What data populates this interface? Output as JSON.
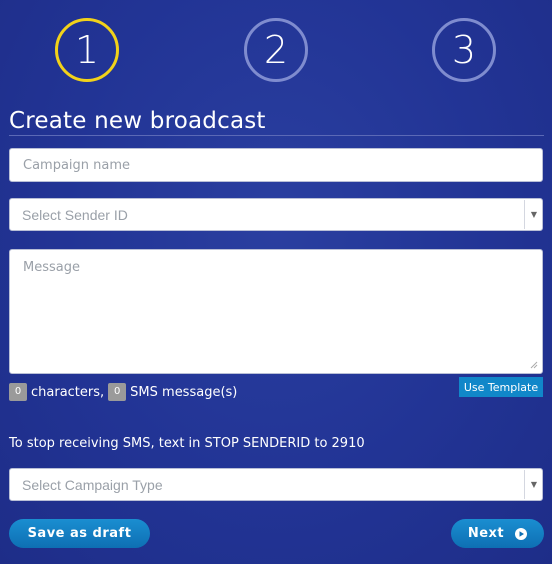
{
  "steps": [
    "1",
    "2",
    "3"
  ],
  "active_step": 1,
  "form": {
    "title": "Create new broadcast",
    "campaign_name_placeholder": "Campaign name",
    "sender_select": "Select Sender ID",
    "message_placeholder": "Message",
    "characters_count": "0",
    "characters_label": "characters,",
    "sms_count": "0",
    "sms_label": "SMS message(s)",
    "use_template": "Use Template",
    "stop_notice": "To stop receiving SMS, text in STOP SENDERID to 2910",
    "campaign_type_select": "Select Campaign Type"
  },
  "buttons": {
    "save_draft": "Save as draft",
    "next": "Next"
  },
  "colors": {
    "background": "#223495",
    "active_step": "#f2d21a",
    "inactive_step": "#7f8ccf",
    "button": "#1187c9"
  }
}
